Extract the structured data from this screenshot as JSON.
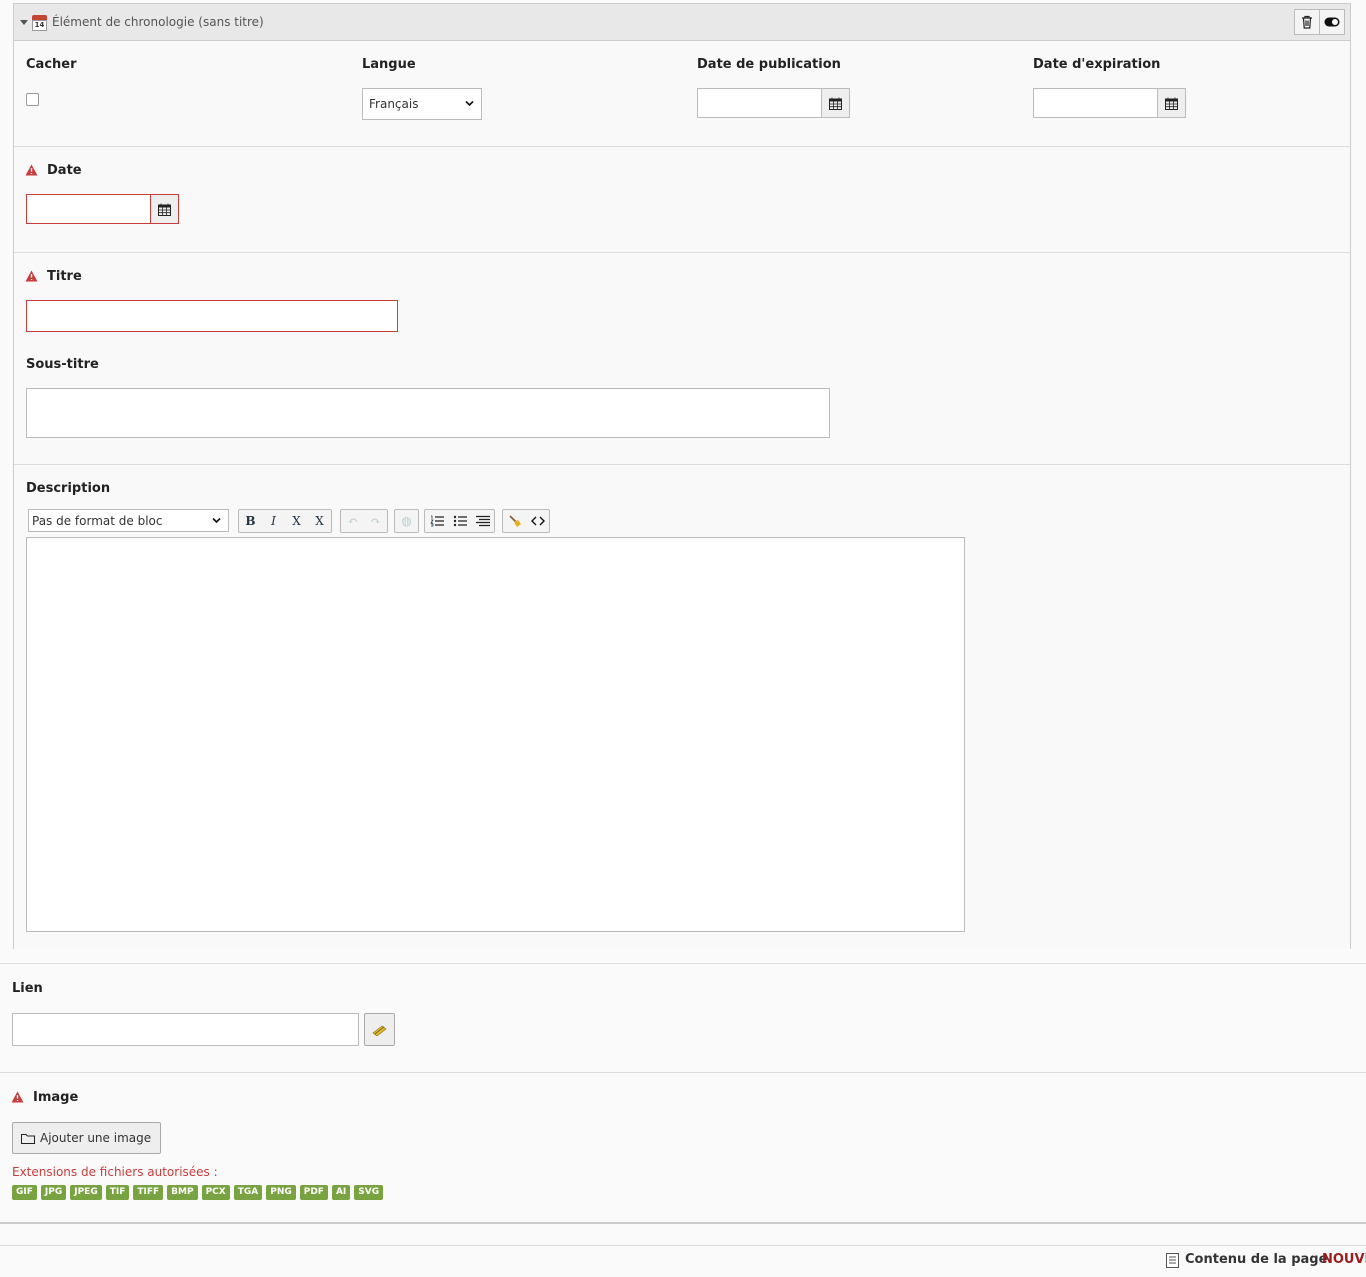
{
  "panel": {
    "title": "Élément de chronologie (sans titre)",
    "icons": [
      "caret-down-icon",
      "calendar-icon",
      "trash-icon",
      "toggle-icon"
    ]
  },
  "fields": {
    "hide_label": "Cacher",
    "language_label": "Langue",
    "language_value": "Français",
    "publish_date_label": "Date de publication",
    "expiry_date_label": "Date d'expiration",
    "date_label": "Date",
    "title_label": "Titre",
    "subtitle_label": "Sous-titre",
    "description_label": "Description",
    "block_format_value": "Pas de format de bloc",
    "link_label": "Lien",
    "image_label": "Image",
    "add_image_label": "Ajouter une image",
    "extensions_label": "Extensions de fichiers autorisées :",
    "extensions": [
      "GIF",
      "JPG",
      "JPEG",
      "TIF",
      "TIFF",
      "BMP",
      "PCX",
      "TGA",
      "PNG",
      "PDF",
      "AI",
      "SVG"
    ]
  },
  "toolbar": {
    "bold": "B",
    "italic": "I",
    "subscript": "X",
    "superscript": "X"
  },
  "footer": {
    "label": "Contenu de la page",
    "value": "NOUVE"
  },
  "colors": {
    "error": "#c83c3c",
    "badge": "#79a340",
    "accent": "#9b1c1c"
  }
}
